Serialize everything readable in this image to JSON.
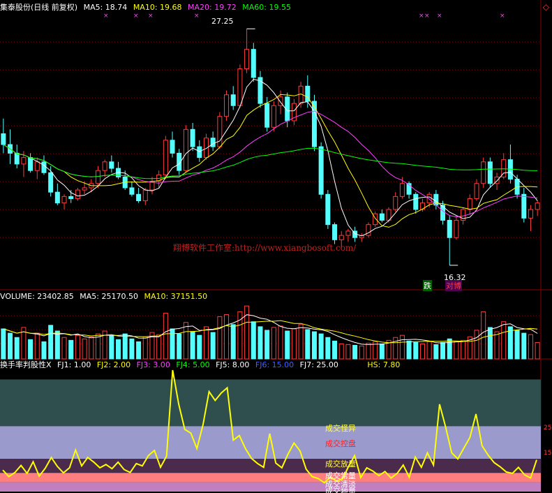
{
  "price_header": {
    "name": "集泰股份(日线 前复权)",
    "ma5": "MA5: 18.74",
    "ma10": "MA10: 19.68",
    "ma20": "MA20: 19.72",
    "ma60": "MA60: 19.55"
  },
  "volume_header": {
    "volume": "VOLUME: 23402.85",
    "ma5": "MA5: 25170.50",
    "ma10": "MA10: 37151.50"
  },
  "indicator_header": {
    "name": "换手率判股性X",
    "fj1": "FJ1: 1.00",
    "fj2": "FJ2: 2.00",
    "fj3": "FJ3: 3.00",
    "fj4": "FJ4: 5.00",
    "fj5": "FJ5: 8.00",
    "fj6": "FJ6: 15.00",
    "fj7": "FJ7: 25.00",
    "hs": "HS: 7.80"
  },
  "annotations": {
    "high": "27.25",
    "low": "16.32",
    "die": "跌",
    "tag": "对博",
    "watermark": "翔博软件工作室:http://www.xiangbosoft.com/"
  },
  "zones": {
    "guaiyi": "成交怪异",
    "kongpan": "成交控盘",
    "fangliang": "成交放量",
    "changliang": "成交常量",
    "jiaohuo": "成交清淡",
    "dixian": "成交地量"
  },
  "right_axis": [
    "25",
    "15"
  ],
  "colors": {
    "up": "#ff3b3b",
    "down": "#54ffff",
    "ma5": "#ffffff",
    "ma10": "#ffff00",
    "ma20": "#ff40ff",
    "ma60": "#00ff00",
    "hs_line": "#ffff00",
    "grid": "#8b0000"
  },
  "chart_data": {
    "type": "candlestick",
    "price_range": [
      16.32,
      27.25
    ],
    "ohlc": [
      [
        22.4,
        23.1,
        21.5,
        21.9
      ],
      [
        21.9,
        22.6,
        21.0,
        21.5
      ],
      [
        21.5,
        21.9,
        20.8,
        21.0
      ],
      [
        21.0,
        21.6,
        20.4,
        21.3
      ],
      [
        21.3,
        21.5,
        20.6,
        20.7
      ],
      [
        20.7,
        21.3,
        20.3,
        21.1
      ],
      [
        21.1,
        21.4,
        20.5,
        20.6
      ],
      [
        20.6,
        20.9,
        19.5,
        19.7
      ],
      [
        19.7,
        20.1,
        19.1,
        19.2
      ],
      [
        19.2,
        19.6,
        18.9,
        19.5
      ],
      [
        19.5,
        19.8,
        19.2,
        19.4
      ],
      [
        19.4,
        19.9,
        19.3,
        19.8
      ],
      [
        19.8,
        20.2,
        19.6,
        19.9
      ],
      [
        19.9,
        20.3,
        19.7,
        20.1
      ],
      [
        20.1,
        20.9,
        19.9,
        20.7
      ],
      [
        20.7,
        21.2,
        20.4,
        21.1
      ],
      [
        21.1,
        21.4,
        20.6,
        20.8
      ],
      [
        20.8,
        21.1,
        20.3,
        20.4
      ],
      [
        20.4,
        20.7,
        19.8,
        19.9
      ],
      [
        19.9,
        20.2,
        19.5,
        19.6
      ],
      [
        19.6,
        19.9,
        19.2,
        19.3
      ],
      [
        19.3,
        19.9,
        19.1,
        19.8
      ],
      [
        19.8,
        20.4,
        19.6,
        20.2
      ],
      [
        20.2,
        20.7,
        19.9,
        20.5
      ],
      [
        20.5,
        22.3,
        20.3,
        22.1
      ],
      [
        22.1,
        22.5,
        21.3,
        21.5
      ],
      [
        21.5,
        21.7,
        20.5,
        20.7
      ],
      [
        20.7,
        22.8,
        20.6,
        22.6
      ],
      [
        22.6,
        22.9,
        21.6,
        21.8
      ],
      [
        21.8,
        22.1,
        21.1,
        21.3
      ],
      [
        21.3,
        22.4,
        21.2,
        22.2
      ],
      [
        22.2,
        22.5,
        21.6,
        21.8
      ],
      [
        21.8,
        23.4,
        21.7,
        23.2
      ],
      [
        23.2,
        24.4,
        23.0,
        24.2
      ],
      [
        24.2,
        24.6,
        23.5,
        23.7
      ],
      [
        23.7,
        25.6,
        23.6,
        25.4
      ],
      [
        25.4,
        27.25,
        25.2,
        26.3
      ],
      [
        26.3,
        26.6,
        24.8,
        25.0
      ],
      [
        25.0,
        25.3,
        23.6,
        23.8
      ],
      [
        23.8,
        24.1,
        22.5,
        22.7
      ],
      [
        22.7,
        23.9,
        22.5,
        23.7
      ],
      [
        23.7,
        24.4,
        23.3,
        24.1
      ],
      [
        24.1,
        24.3,
        22.7,
        23.0
      ],
      [
        23.0,
        24.0,
        22.8,
        23.8
      ],
      [
        23.8,
        24.8,
        23.6,
        24.6
      ],
      [
        24.6,
        25.1,
        23.6,
        23.9
      ],
      [
        23.9,
        24.2,
        21.6,
        21.8
      ],
      [
        21.8,
        22.0,
        19.4,
        19.6
      ],
      [
        19.6,
        19.8,
        18.0,
        18.2
      ],
      [
        18.2,
        18.3,
        17.3,
        17.5
      ],
      [
        17.5,
        17.9,
        17.1,
        17.7
      ],
      [
        17.7,
        18.0,
        17.4,
        17.9
      ],
      [
        17.9,
        18.1,
        17.4,
        17.6
      ],
      [
        17.6,
        17.8,
        17.4,
        17.7
      ],
      [
        17.7,
        18.3,
        17.6,
        18.2
      ],
      [
        18.2,
        18.8,
        18.1,
        18.7
      ],
      [
        18.7,
        18.9,
        18.3,
        18.4
      ],
      [
        18.4,
        19.0,
        18.3,
        18.9
      ],
      [
        18.9,
        19.7,
        18.8,
        19.5
      ],
      [
        19.5,
        20.4,
        19.4,
        20.1
      ],
      [
        20.1,
        20.2,
        19.4,
        19.6
      ],
      [
        19.6,
        19.7,
        18.7,
        18.9
      ],
      [
        18.9,
        19.4,
        18.8,
        19.2
      ],
      [
        19.2,
        19.7,
        19.0,
        19.6
      ],
      [
        19.6,
        19.8,
        18.9,
        19.1
      ],
      [
        19.1,
        19.3,
        18.2,
        18.4
      ],
      [
        18.4,
        18.6,
        16.32,
        17.6
      ],
      [
        17.6,
        18.6,
        17.5,
        18.4
      ],
      [
        18.4,
        19.0,
        18.2,
        18.9
      ],
      [
        18.9,
        19.6,
        18.7,
        19.4
      ],
      [
        19.4,
        20.3,
        19.3,
        20.1
      ],
      [
        20.1,
        21.3,
        19.9,
        21.1
      ],
      [
        21.1,
        21.3,
        19.9,
        20.1
      ],
      [
        20.1,
        20.6,
        19.8,
        20.4
      ],
      [
        20.4,
        21.5,
        20.3,
        21.2
      ],
      [
        21.2,
        21.9,
        20.1,
        20.3
      ],
      [
        20.3,
        20.5,
        19.4,
        19.6
      ],
      [
        19.6,
        19.9,
        18.3,
        18.5
      ],
      [
        18.5,
        19.1,
        17.9,
        18.9
      ],
      [
        18.9,
        19.3,
        18.6,
        19.2
      ]
    ],
    "volume_range": [
      0,
      80000
    ],
    "volume": [
      42000,
      36000,
      30000,
      44000,
      27000,
      36000,
      24000,
      47000,
      39000,
      30000,
      26000,
      33000,
      28000,
      31000,
      35000,
      39000,
      32000,
      27000,
      35000,
      28000,
      24000,
      31000,
      37000,
      34000,
      64000,
      42000,
      35000,
      51000,
      38000,
      33000,
      45000,
      37000,
      59000,
      62000,
      48000,
      66000,
      74000,
      52000,
      45000,
      40000,
      44000,
      46000,
      39000,
      42000,
      48000,
      41000,
      38000,
      35000,
      30000,
      25000,
      21000,
      20000,
      19000,
      18000,
      22000,
      24000,
      21000,
      26000,
      30000,
      33000,
      25000,
      23000,
      21000,
      24000,
      20000,
      23000,
      28000,
      24000,
      26000,
      31000,
      40000,
      66000,
      44000,
      38000,
      52000,
      45000,
      40000,
      36000,
      34000,
      23000
    ],
    "hs_range": [
      1,
      27
    ],
    "hs": [
      5.6,
      4.2,
      5.1,
      6.6,
      4.9,
      7.4,
      4.3,
      6.0,
      8.3,
      6.4,
      5.0,
      6.1,
      9.9,
      6.5,
      8.3,
      7.3,
      6.1,
      6.8,
      5.9,
      7.3,
      5.7,
      5.1,
      7.0,
      6.5,
      8.7,
      9.8,
      6.2,
      8.6,
      27.0,
      19.7,
      14.3,
      13.5,
      10.2,
      15.3,
      22.4,
      20.5,
      22.1,
      23.2,
      12.0,
      13.0,
      10.2,
      8.1,
      7.0,
      6.2,
      13.4,
      7.1,
      6.1,
      9.0,
      11.4,
      9.7,
      5.8,
      4.2,
      3.8,
      2.9,
      4.1,
      3.3,
      3.7,
      6.4,
      8.7,
      4.0,
      6.1,
      5.4,
      4.4,
      5.3,
      3.9,
      4.9,
      6.7,
      4.1,
      8.4,
      6.2,
      9.3,
      6.7,
      19.7,
      14.8,
      9.3,
      8.0,
      10.3,
      12.6,
      17.6,
      10.8,
      8.8,
      7.2,
      6.3,
      5.2,
      4.9,
      6.2,
      4.6,
      3.9,
      7.8
    ]
  }
}
